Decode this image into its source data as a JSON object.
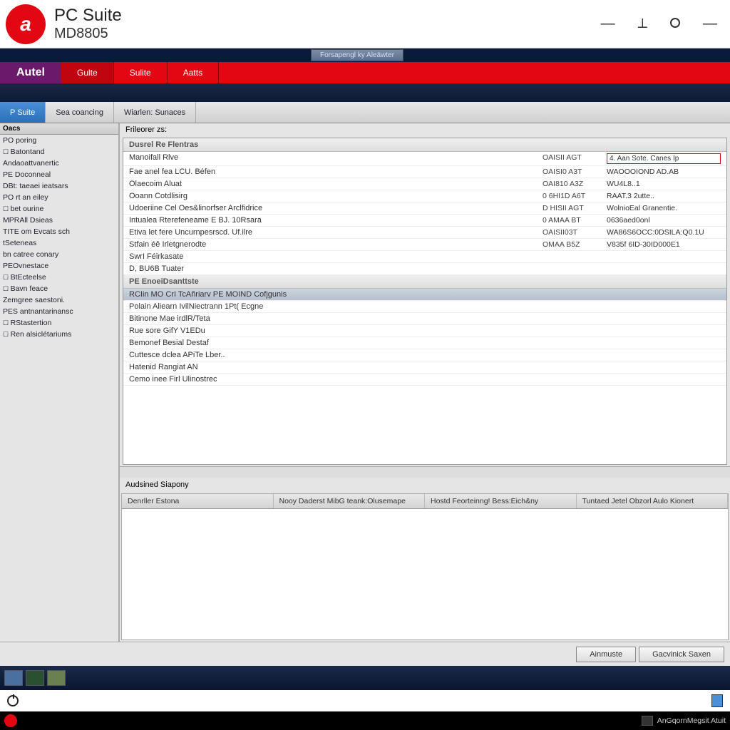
{
  "titlebar": {
    "main": "PC Suite",
    "sub": "MD8805"
  },
  "embed_button": "Forsapengl ky Aleäwter",
  "autel_label": "Autel",
  "red_tabs": [
    "Gulte",
    "Sulite",
    "Aatts"
  ],
  "sub_tabs": [
    "P Suite",
    "Sea coancing",
    "Wiarlen: Sunaces"
  ],
  "sidebar": {
    "header": "Oacs",
    "items": [
      {
        "t": "PO poring",
        "c": false
      },
      {
        "t": "Batontand",
        "c": true
      },
      {
        "t": "Andaoattvanertic",
        "c": false
      },
      {
        "t": "PE Doconneal",
        "c": false
      },
      {
        "t": "DBt: taeaei ieatsars",
        "c": false
      },
      {
        "t": "PO rt an eiley",
        "c": false
      },
      {
        "t": "bet ourine",
        "c": true
      },
      {
        "t": "MPRAll Dsieas",
        "c": false
      },
      {
        "t": "TITE om Evcats sch",
        "c": false
      },
      {
        "t": "tSeteneas",
        "c": false
      },
      {
        "t": "bn catree conary",
        "c": false
      },
      {
        "t": "PEOvnestace",
        "c": false
      },
      {
        "t": "BtEcteelse",
        "c": true
      },
      {
        "t": "Bavn feace",
        "c": true
      },
      {
        "t": "Zemgree saestoni.",
        "c": false
      },
      {
        "t": "PES antnantarinansc",
        "c": false
      },
      {
        "t": "RStastertion",
        "c": true
      },
      {
        "t": "Ren alsiclétariums",
        "c": true
      }
    ]
  },
  "content_header": "Frileorer zs:",
  "group1": {
    "title": "Dusrel Re Flentras",
    "rows": [
      {
        "n": "Manoifall Rlve",
        "c": "OAISII AGT",
        "d": "4. Aan Sote. Canes Ip",
        "red": true
      },
      {
        "n": "Fae anel fea LCU. Béfen",
        "c": "OAISI0 A3T",
        "d": "WAOOOIOND AD.AB"
      },
      {
        "n": "Olaecoim Aluat",
        "c": "OAI810 A3Z",
        "d": "WU4L8..1"
      },
      {
        "n": "Ooann Cotdlisirg",
        "c": "0 6HI1D A6T",
        "d": "RAAT.3 2utte.."
      },
      {
        "n": "Udoeriine Cel Oes&linorfser Arclfidrice",
        "c": "D HISII AGT",
        "d": "WolnioEal Granentie."
      },
      {
        "n": "Intualea Rterefeneame E BJ. 10Rsara",
        "c": "0 AMAA BT",
        "d": "0636aed0onl"
      },
      {
        "n": "Etiva let fere Uncurnpesrscd. Uf.ilre",
        "c": "OAISII03T",
        "d": "WA86S6OCC:0DSILA:Q0.1U"
      },
      {
        "n": "Stfain éê Irletgnerodte",
        "c": "OMAA B5Z",
        "d": "V835f 6ID-30ID000E1"
      },
      {
        "n": "SwrI Féirkasate",
        "c": "",
        "d": ""
      },
      {
        "n": "D, BU6B Tuater",
        "c": "",
        "d": ""
      }
    ]
  },
  "group2": {
    "title": "PE EnoeiDsanttste",
    "rows": [
      {
        "n": "RCIin MO CrI TcAñriarv PE MOIND Cofjgunis",
        "sel": true
      },
      {
        "n": "Polain Aliearn IvilNiectrann 1Pt( Ecgne"
      },
      {
        "n": "Bitinone Mae irdlR/Teta"
      },
      {
        "n": "Rue sore GifY V1EDu"
      },
      {
        "n": "Bemonef Besial Destaf"
      },
      {
        "n": "Cuttesce dclea APiTe Lber.."
      },
      {
        "n": "Hatenid Rangiat AN"
      },
      {
        "n": "Cemo inee Firl Ulinostrec"
      }
    ]
  },
  "bottom": {
    "header": "Audsined Siapony",
    "cols": [
      "Denrller Estona",
      "Nooy Daderst MibG teank:Olusemape",
      "Hostd Feorteinng! Bess:Eich&ny",
      "Tuntaed Jetel Obzorl Aulo Kionert"
    ]
  },
  "footer": {
    "b1": "Ainmuste",
    "b2": "Gacvinick Saxen"
  },
  "taskbar3_text": "AnGqornMegsit Atuit"
}
